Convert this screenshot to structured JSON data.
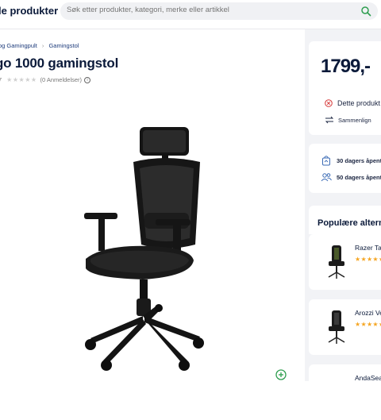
{
  "header": {
    "nav_label": "le produkter",
    "search_placeholder": "Søk etter produkter, kategori, merke eller artikkel"
  },
  "breadcrumb": {
    "items": [
      "og Gamingpult",
      "Gamingstol"
    ]
  },
  "product": {
    "title": "go 1000 gamingstol",
    "sku_fragment": "7",
    "reviews_text": "(0 Anmeldelser)",
    "rating": 0
  },
  "price_card": {
    "price": "1799,-",
    "stock_text": "Dette produkt",
    "compare_label": "Sammenlign"
  },
  "perks": [
    {
      "icon": "return-bag-icon",
      "label": "30 dagers åpent"
    },
    {
      "icon": "users-icon",
      "label": "50 dagers åpent"
    }
  ],
  "alternatives": {
    "title": "Populære alterna",
    "items": [
      {
        "name": "Razer Tarc",
        "stars": "★★★★★"
      },
      {
        "name": "Arozzi Ve",
        "stars": "★★★★★"
      },
      {
        "name": "AndaSeat",
        "stars": ""
      }
    ]
  },
  "colors": {
    "brand_navy": "#0b1a3a",
    "accent_green": "#2e9e4f",
    "error_red": "#d63b3b",
    "star_orange": "#f5a623"
  }
}
